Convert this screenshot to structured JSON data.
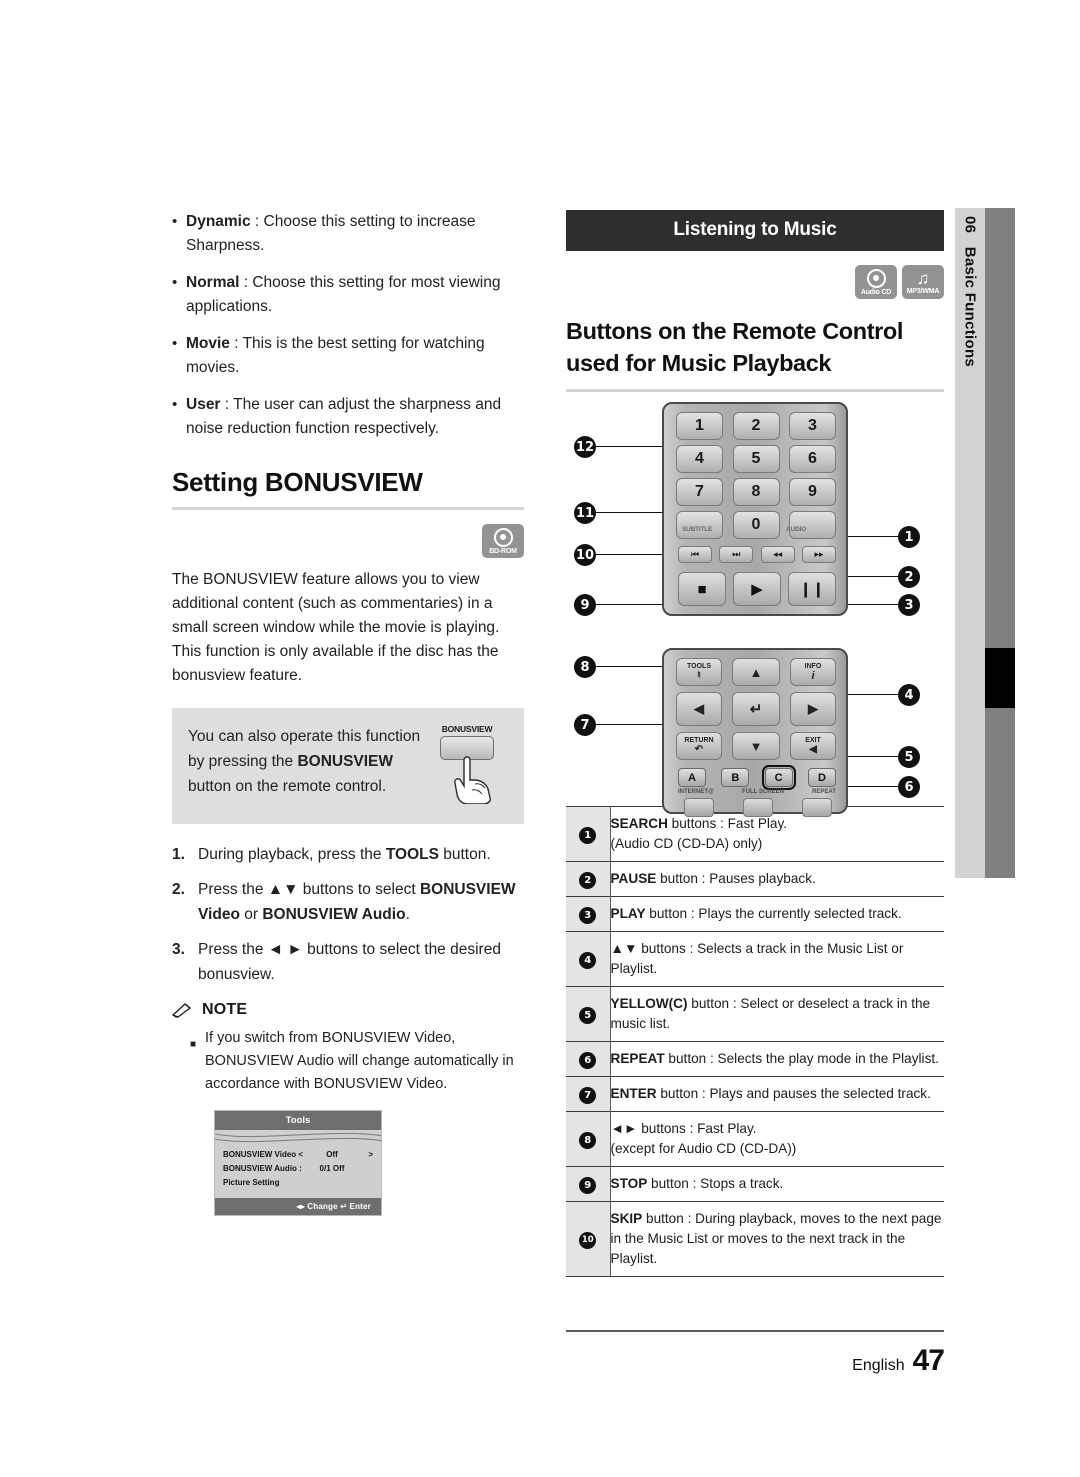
{
  "side_tab": {
    "chapter_number": "06",
    "chapter_title": "Basic Functions"
  },
  "left": {
    "bullets": [
      {
        "term": "Dynamic",
        "sep": " : ",
        "text": "Choose this setting to increase Sharpness."
      },
      {
        "term": "Normal",
        "sep": " : ",
        "text": "Choose this setting for most viewing applications."
      },
      {
        "term": "Movie",
        "sep": " : ",
        "text": "This is the best setting for watching movies."
      },
      {
        "term": "User",
        "sep": " : ",
        "text": "The user can adjust the sharpness and noise reduction function respectively."
      }
    ],
    "section_title": "Setting BONUSVIEW",
    "disc_icon_label": "BD-ROM",
    "body": "The BONUSVIEW feature allows you to view additional content (such as commentaries) in a small screen window while the movie is playing. This function is only available if the disc has the bonusview feature.",
    "tip": {
      "part1": "You can also operate this function by pressing the ",
      "bold": "BONUSVIEW",
      "part2": " button on the remote control.",
      "button_label": "BONUSVIEW"
    },
    "steps": [
      {
        "num": "1.",
        "pre": "During playback, press the ",
        "bold": "TOOLS",
        "post": " button."
      },
      {
        "num": "2.",
        "pre": "Press the ▲▼ buttons to select ",
        "bold": "BONUSVIEW Video",
        "mid": " or ",
        "bold2": "BONUSVIEW Audio",
        "post": "."
      },
      {
        "num": "3.",
        "pre": "Press the ◄ ► buttons to select the desired bonusview.",
        "bold": "",
        "post": ""
      }
    ],
    "note_heading": "NOTE",
    "note_items": [
      "If you switch from BONUSVIEW Video, BONUSVIEW Audio will change automatically in accordance with BONUSVIEW Video."
    ],
    "osd": {
      "title": "Tools",
      "rows": [
        {
          "key": "BONUSVIEW Video <",
          "value": "Off",
          "arrow": ">"
        },
        {
          "key": "BONUSVIEW Audio :",
          "value": "0/1 Off",
          "arrow": ""
        },
        {
          "key": "Picture Setting",
          "value": "",
          "arrow": ""
        }
      ],
      "footer": "◂▸ Change      ↵ Enter"
    }
  },
  "right": {
    "banner": "Listening to Music",
    "icons": [
      {
        "name": "audio-cd-icon",
        "label": "Audio CD"
      },
      {
        "name": "mp3-wma-icon",
        "label": "MP3/WMA"
      }
    ],
    "title": "Buttons on the Remote Control used for Music Playback",
    "remote": {
      "number_keys": [
        "1",
        "2",
        "3",
        "4",
        "5",
        "6",
        "7",
        "8",
        "9",
        "0"
      ],
      "subtitle_label": "SUBTITLE",
      "audio_label": "AUDIO",
      "track_keys": [
        "⏮",
        "⏭",
        "◂◂",
        "▸▸"
      ],
      "transport_keys": [
        "■",
        "▶",
        "❙❙"
      ],
      "tools_label": "TOOLS",
      "info_label": "INFO",
      "return_label": "RETURN",
      "exit_label": "EXIT",
      "color_keys": [
        "A",
        "B",
        "C",
        "D"
      ],
      "function_labels": [
        "INTERNET@",
        "FULL SCREEN",
        "REPEAT"
      ],
      "callouts": [
        "1",
        "2",
        "3",
        "4",
        "5",
        "6",
        "7",
        "8",
        "9",
        "10",
        "11",
        "12"
      ]
    },
    "table": [
      {
        "num": "1",
        "bold": "SEARCH",
        "rest": " buttons : Fast Play.",
        "line2": "(Audio CD (CD-DA) only)"
      },
      {
        "num": "2",
        "bold": "PAUSE",
        "rest": " button : Pauses playback.",
        "line2": ""
      },
      {
        "num": "3",
        "bold": "PLAY",
        "rest": " button : Plays the currently selected track.",
        "line2": ""
      },
      {
        "num": "4",
        "bold": "▲▼",
        "rest": " buttons : Selects a track in the Music List or Playlist.",
        "line2": ""
      },
      {
        "num": "5",
        "bold": "YELLOW(C)",
        "rest": " button : Select or deselect a track in the music list.",
        "line2": ""
      },
      {
        "num": "6",
        "bold": "REPEAT",
        "rest": " button : Selects the play mode in the Playlist.",
        "line2": ""
      },
      {
        "num": "7",
        "bold": "ENTER",
        "rest": " button : Plays and pauses the selected track.",
        "line2": ""
      },
      {
        "num": "8",
        "bold": "◄►",
        "rest": " buttons : Fast Play.",
        "line2": "(except for Audio CD (CD-DA))"
      },
      {
        "num": "9",
        "bold": "STOP",
        "rest": " button : Stops a track.",
        "line2": ""
      },
      {
        "num": "10",
        "bold": "SKIP",
        "rest": " button : During playback, moves to the next page in the Music List or moves to the next track in the Playlist.",
        "line2": ""
      }
    ]
  },
  "footer": {
    "language": "English",
    "page": "47"
  }
}
